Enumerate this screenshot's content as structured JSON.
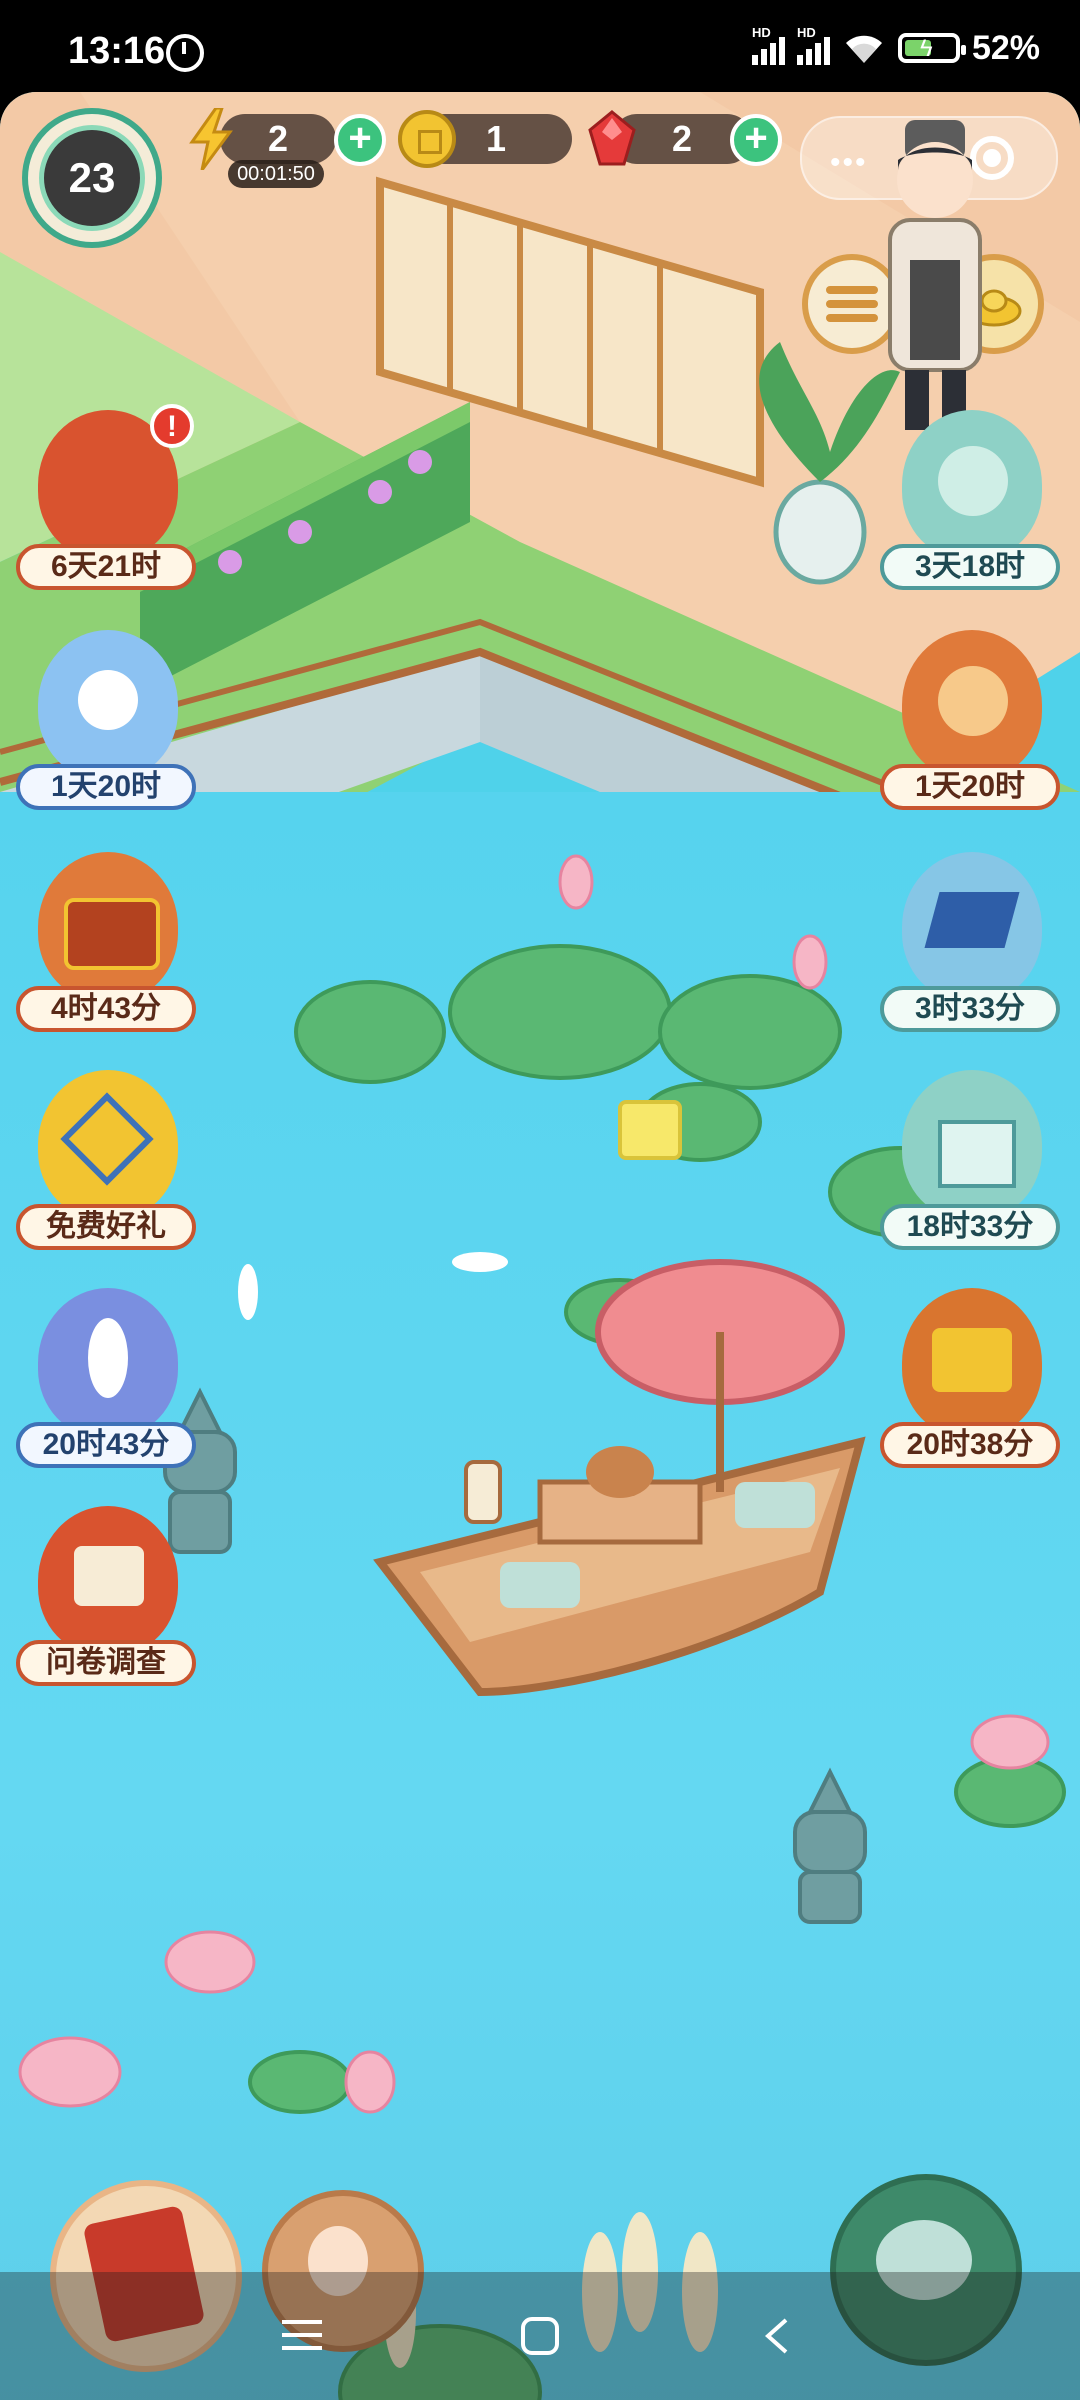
{
  "status_bar": {
    "time": "13:16",
    "alarm_icon": "alarm-icon",
    "signal1_tag": "HD",
    "signal2_tag": "HD",
    "battery_percent_value": 52,
    "battery_text": "52%"
  },
  "hud": {
    "level": "23",
    "energy": "2",
    "energy_timer": "00:01:50",
    "coins": "1",
    "gems": "2",
    "capsule_more_icon": "more-dots-icon",
    "capsule_close_icon": "target-close-icon",
    "menu_icon": "list-menu-icon",
    "shop_icon": "gold-ingot-shop-icon"
  },
  "left_events": [
    {
      "label": "6天21时",
      "icon": "red-envelope-letter-icon",
      "has_alert": true,
      "alert": "!"
    },
    {
      "label": "1天20时",
      "icon": "snowman-cat-icon"
    },
    {
      "label": "4时43分",
      "icon": "treasure-chest-icon"
    },
    {
      "label": "免费好礼",
      "icon": "free-gift-icon"
    },
    {
      "label": "20时43分",
      "icon": "crane-coins-icon"
    },
    {
      "label": "问卷调查",
      "icon": "survey-scroll-icon"
    }
  ],
  "right_events": [
    {
      "label": "3天18时",
      "icon": "dragon-cat-icon"
    },
    {
      "label": "1天20时",
      "icon": "fortune-cat-icon"
    },
    {
      "label": "3时33分",
      "icon": "blue-carpet-icon"
    },
    {
      "label": "18时33分",
      "icon": "gift-box-cat-icon"
    },
    {
      "label": "20时38分",
      "icon": "coin-board-icon"
    }
  ],
  "bottom": {
    "left_icon": "red-book-icon",
    "middle_icon": "lady-portrait-icon",
    "right_icon": "teapot-rabbit-icon"
  },
  "nav": {
    "menu_icon": "nav-menu-icon",
    "home_icon": "nav-home-icon",
    "back_icon": "nav-back-icon"
  },
  "colors": {
    "pond": "#56d3ee",
    "accent_green": "#3cc37e",
    "label_red": "#c8552f"
  }
}
